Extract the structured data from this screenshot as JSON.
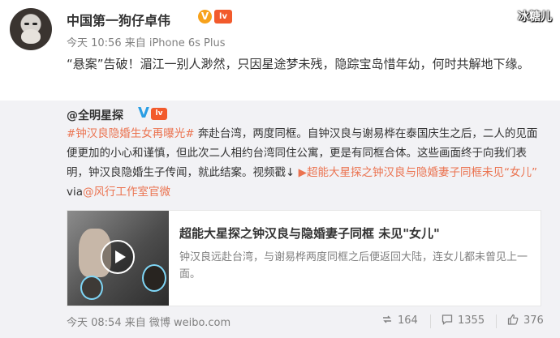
{
  "post": {
    "username": "中国第一狗仔卓伟",
    "verified_badge": "V",
    "level_badge": "lv",
    "timestamp_source": "今天 10:56 来自 iPhone 6s Plus",
    "text": "“悬案”告破！湄江一别人渺然，只因星途梦未残，隐踪宝岛惜年幼，何时共解地下缘。",
    "watermark": "冰糖儿"
  },
  "repost": {
    "original_user": "@全明星探",
    "verified_badge": "V",
    "level_badge": "lv",
    "hashtag": "#钟汉良隐婚生女再曝光#",
    "body": " 奔赴台湾，两度同框。自钟汉良与谢易桦在泰国庆生之后，二人的见面便更加的小心和谨慎，但此次二人相约台湾同住公寓，更是有同框合体。这些画面终于向我们表明，钟汉良隐婚生子传闻，就此结案。视频戳↓",
    "video_link": "超能大星探之钟汉良与隐婚妻子同框未见“女儿”",
    "via": " via",
    "via_link": "@风行工作室官微",
    "card": {
      "title": "超能大星探之钟汉良与隐婚妻子同框 未见\"女儿\"",
      "description": "钟汉良远赴台湾，与谢易桦两度同框之后便返回大陆，连女儿都未曾见上一面。",
      "play_icon": "play-icon"
    },
    "footer_meta": "今天 08:54 来自 微博 weibo.com",
    "actions": {
      "repost_count": "164",
      "comment_count": "1355",
      "like_count": "376"
    }
  },
  "colors": {
    "link": "#eb7350",
    "verified_blue": "#2a9ee4",
    "verified_orange": "#f7a21b",
    "repost_bg": "#f2f2f5"
  }
}
